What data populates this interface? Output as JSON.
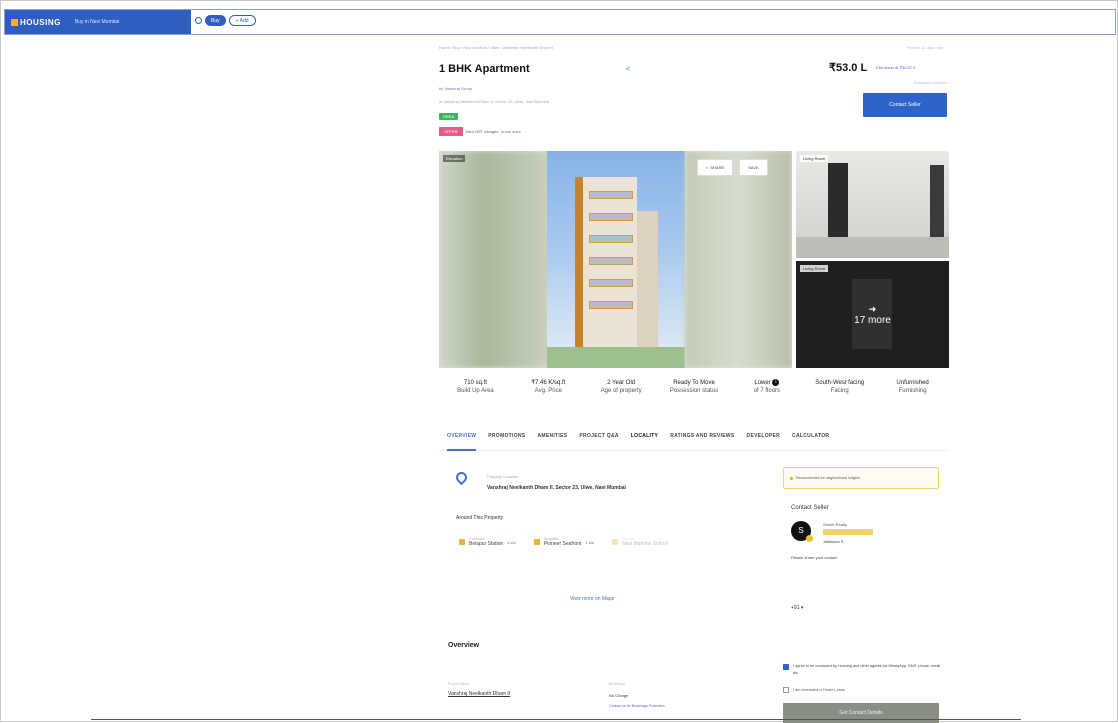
{
  "header": {
    "logo_text": "HOUSING",
    "city": "Buy in Navi Mumbai",
    "pills": [
      "Buy",
      "+ Add"
    ]
  },
  "listing": {
    "breadcrumb": "Home / Buy / Navi Mumbai / Ulwe / Vaishnavi Neelkanth Dham II",
    "breadcrumb_right": "Posted: 10 days ago",
    "title": "1 BHK Apartment",
    "by": "by Vanshraj Group",
    "address": "in Vanshraj Neelkanth Dham II, Sector 23, Ulwe, Navi Mumbai",
    "rera": "RERA",
    "offer_tag": "OFFER",
    "offer_text": "Zero GST charges",
    "offer_link": "know more",
    "price": "₹53.0 L",
    "emi": "EMI starts at ₹30.57 K",
    "price_sub": "Estimated charges",
    "contact_label": "Contact Seller"
  },
  "gallery": {
    "main_tag": "Elevation",
    "share_label": "SHARE",
    "save_label": "SAVE",
    "side1_tag": "Living Room",
    "side2_tag": "Living Room",
    "more_label": "17 more"
  },
  "specs": [
    {
      "value": "710 sq.ft",
      "label": "Build Up Area"
    },
    {
      "value": "₹7.46 K/sq.ft",
      "label": "Avg. Price"
    },
    {
      "value": "2 Year Old",
      "label": "Age of property"
    },
    {
      "value": "Ready To Move",
      "label": "Possession status"
    },
    {
      "value": "Lower",
      "label": "of 7 floors"
    },
    {
      "value": "South-West facing",
      "label": "Facing"
    },
    {
      "value": "Unfurnished",
      "label": "Furnishing"
    }
  ],
  "spec_info_glyph": "i",
  "tabs": [
    "OVERVIEW",
    "PROMOTIONS",
    "AMENITIES",
    "PROJECT Q&A",
    "LOCALITY",
    "RATINGS AND REVIEWS",
    "DEVELOPER",
    "CALCULATOR"
  ],
  "locality": {
    "label": "Property Location",
    "value": "Vanshraj Neelkanth Dham II, Sector 23, Ulwe, Navi Mumbai",
    "around": "Around This Property",
    "nearby": [
      {
        "type": "Commute",
        "name": "Belapur Station",
        "km": "4 km"
      },
      {
        "type": "Hospitals",
        "name": "Pioneer Seafront",
        "km": "1 km"
      },
      {
        "type": "Schools",
        "name": "Navi Mumbai School",
        "km": ""
      }
    ],
    "view_more": "View more on Maps"
  },
  "overview": {
    "heading": "Overview",
    "label1": "Project Name",
    "value1": "Vanshraj Neelkanth Dham II",
    "label2": "Brokerage",
    "value2": "No Charge",
    "link2": "Contact us for Brokerage Protection"
  },
  "contact_panel": {
    "notice": "Recommended for neighborhood insights",
    "title": "Contact Seller",
    "avatar_initial": "S",
    "agent_name": "Shubh Realty",
    "agent_sub": "Jaikishan S.",
    "phone_label": "Please share your contact",
    "country_code": "+91 ▾",
    "agree_text": "I agree to be contacted by Housing and other agents via WhatsApp, SMS, phone, email etc",
    "home_text": "I am interested in Home Loans",
    "button": "Get Contact Details"
  },
  "colors": {
    "brand_blue": "#2e5ebf",
    "accent_blue": "#4a6fc4",
    "offer_pink": "#e65a8c",
    "rera_green": "#3cb55a"
  }
}
